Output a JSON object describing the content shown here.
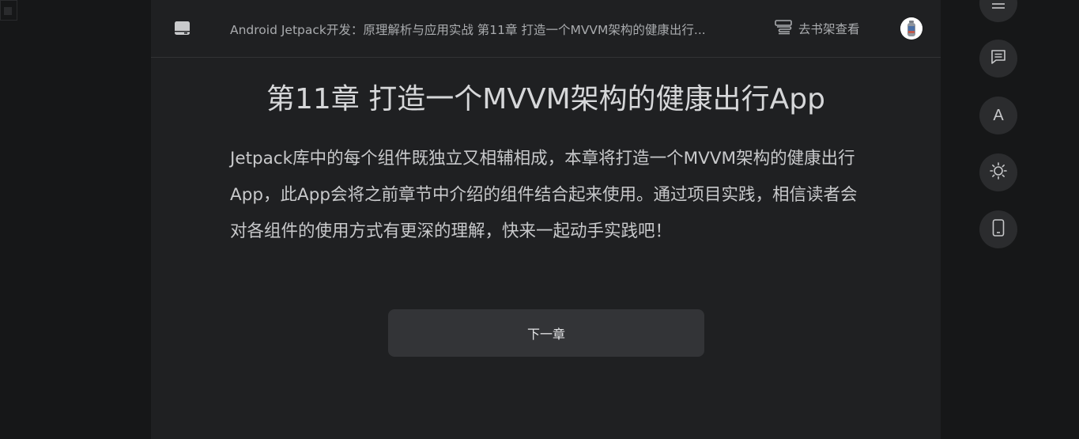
{
  "header": {
    "book_title": "Android Jetpack开发：原理解析与应用实战 第11章 打造一个MVVM架构的健康出行...",
    "shelf_label": "去书架查看"
  },
  "chapter": {
    "title": "第11章 打造一个MVVM架构的健康出行App",
    "body": "Jetpack库中的每个组件既独立又相辅相成，本章将打造一个MVVM架构的健康出行App，此App会将之前章节中介绍的组件结合起来使用。通过项目实践，相信读者会对各组件的使用方式有更深的理解，快来一起动手实践吧！"
  },
  "navigation": {
    "next_label": "下一章"
  },
  "sidebar": {
    "font_letter": "A",
    "icons": [
      "menu-icon",
      "comment-icon",
      "font-size-icon",
      "brightness-icon",
      "phone-icon"
    ]
  },
  "colors": {
    "background": "#161718",
    "reader_bg": "#1f2022",
    "button_bg": "#333437",
    "side_button_bg": "#2b2c2e",
    "text": "#c8c9cb"
  }
}
